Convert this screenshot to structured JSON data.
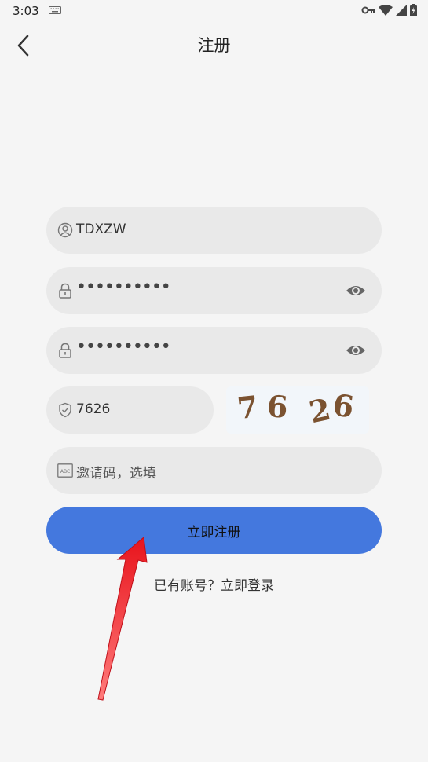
{
  "status_bar": {
    "time": "3:03",
    "icons": [
      "keyboard-icon",
      "key-icon",
      "wifi-icon",
      "signal-icon",
      "battery-icon"
    ]
  },
  "header": {
    "title": "注册",
    "back_icon": "chevron-left-icon"
  },
  "form": {
    "username": {
      "value": "TDXZW",
      "icon": "user-icon"
    },
    "password": {
      "value": "••••••••••",
      "icon": "lock-icon",
      "toggle_icon": "eye-icon"
    },
    "confirm_password": {
      "value": "••••••••••",
      "icon": "lock-icon",
      "toggle_icon": "eye-icon"
    },
    "captcha": {
      "value": "7626",
      "icon": "shield-check-icon",
      "image_text": "7626"
    },
    "invite_code": {
      "placeholder": "邀请码，选填",
      "icon": "abc-icon"
    }
  },
  "actions": {
    "submit_label": "立即注册",
    "login_link": "已有账号？立即登录"
  },
  "annotation": {
    "type": "red-arrow",
    "points_to": "submit-button",
    "color": "#e8141c"
  }
}
